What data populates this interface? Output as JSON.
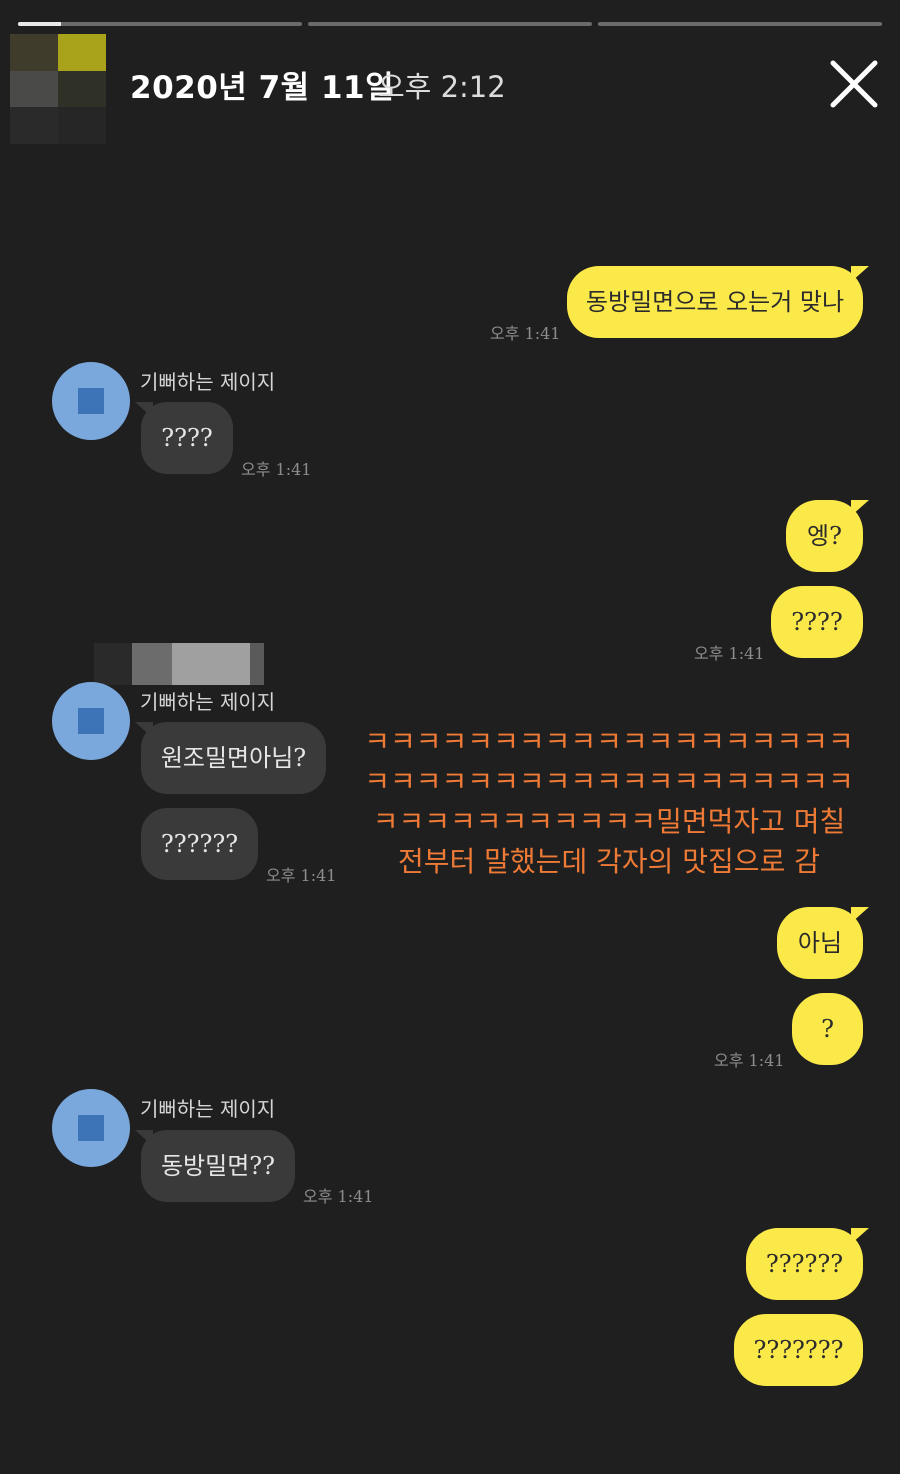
{
  "story": {
    "date": "2020년 7월 11일",
    "time": "오후 2:12",
    "progress": [
      0.15,
      0,
      0
    ]
  },
  "chat": {
    "messages": [
      {
        "id": "m1",
        "side": "out",
        "text": "동방밀면으로 오는거 맞나"
      },
      {
        "id": "m2",
        "side": "in",
        "text": "????"
      },
      {
        "id": "m3",
        "side": "out",
        "text": "엥?"
      },
      {
        "id": "m4",
        "side": "out",
        "text": "????"
      },
      {
        "id": "m5",
        "side": "in",
        "text": "원조밀면아님?"
      },
      {
        "id": "m6",
        "side": "in",
        "text": "??????"
      },
      {
        "id": "m7",
        "side": "out",
        "text": "아님"
      },
      {
        "id": "m8",
        "side": "out",
        "text": "?"
      },
      {
        "id": "m9",
        "side": "in",
        "text": "동방밀면??"
      },
      {
        "id": "m10",
        "side": "out",
        "text": "??????"
      },
      {
        "id": "m11",
        "side": "out",
        "text": "???????"
      }
    ],
    "sender_name": "기뻐하는 제이지",
    "timestamps": [
      "오후 1:41",
      "오후 1:41",
      "오후 1:41",
      "오후 1:41",
      "오후 1:41",
      "오후 1:41"
    ]
  },
  "caption": "ㅋㅋㅋㅋㅋㅋㅋㅋㅋㅋㅋㅋㅋㅋㅋㅋㅋㅋㅋㅋㅋㅋㅋㅋㅋㅋㅋㅋㅋㅋㅋㅋㅋㅋㅋㅋㅋㅋㅋㅋㅋㅋㅋㅋㅋㅋㅋㅋㅋ밀면먹자고 며칠전부터 말했는데 각자의 맛집으로 감",
  "colors": {
    "background": "#1f1f20",
    "outgoing_bubble": "#fbe94a",
    "incoming_bubble": "#3a3a3b",
    "profile_avatar": "#7aa8dc",
    "caption": "#ee7a36"
  },
  "icons": {
    "close": "close-icon",
    "profile": "profile-avatar-icon"
  }
}
